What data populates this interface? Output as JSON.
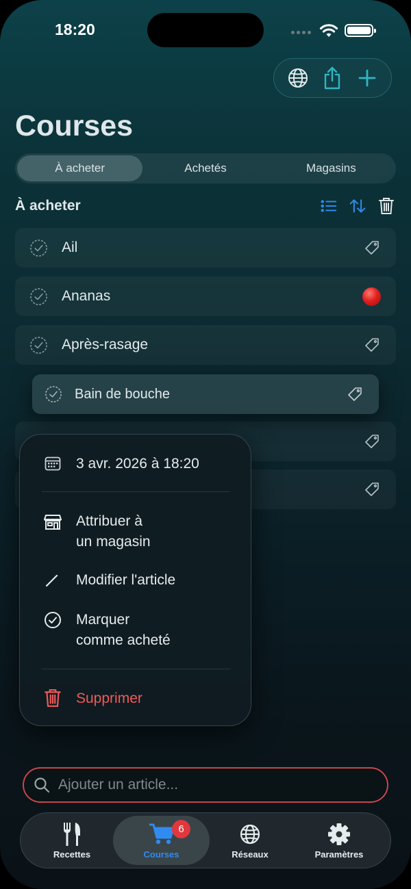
{
  "status_bar": {
    "time": "18:20"
  },
  "header": {
    "title": "Courses"
  },
  "segments": [
    {
      "label": "À acheter",
      "active": true
    },
    {
      "label": "Achetés",
      "active": false
    },
    {
      "label": "Magasins",
      "active": false
    }
  ],
  "section": {
    "title": "À acheter"
  },
  "items": [
    {
      "label": "Ail",
      "marker": "tag-icon"
    },
    {
      "label": "Ananas",
      "marker": "red-dot"
    },
    {
      "label": "Après-rasage",
      "marker": "tag-icon"
    },
    {
      "label": "Bain de bouche",
      "marker": "tag-icon"
    }
  ],
  "context_menu": {
    "date": "3 avr. 2026 à 18:20",
    "assign_store_line1": "Attribuer à",
    "assign_store_line2": "un magasin",
    "edit_item": "Modifier l'article",
    "mark_bought_line1": "Marquer",
    "mark_bought_line2": "comme acheté",
    "delete": "Supprimer"
  },
  "add_field": {
    "placeholder": "Ajouter un article..."
  },
  "tabbar": {
    "tabs": [
      {
        "label": "Recettes",
        "icon": "fork-knife-icon"
      },
      {
        "label": "Courses",
        "icon": "cart-icon",
        "badge": "6",
        "active": true
      },
      {
        "label": "Réseaux",
        "icon": "globe-icon"
      },
      {
        "label": "Paramètres",
        "icon": "gear-icon"
      }
    ]
  },
  "colors": {
    "accent": "#2f8bef",
    "danger": "#f05a5a",
    "badge": "#e0383c",
    "field_border": "#c9464b"
  }
}
